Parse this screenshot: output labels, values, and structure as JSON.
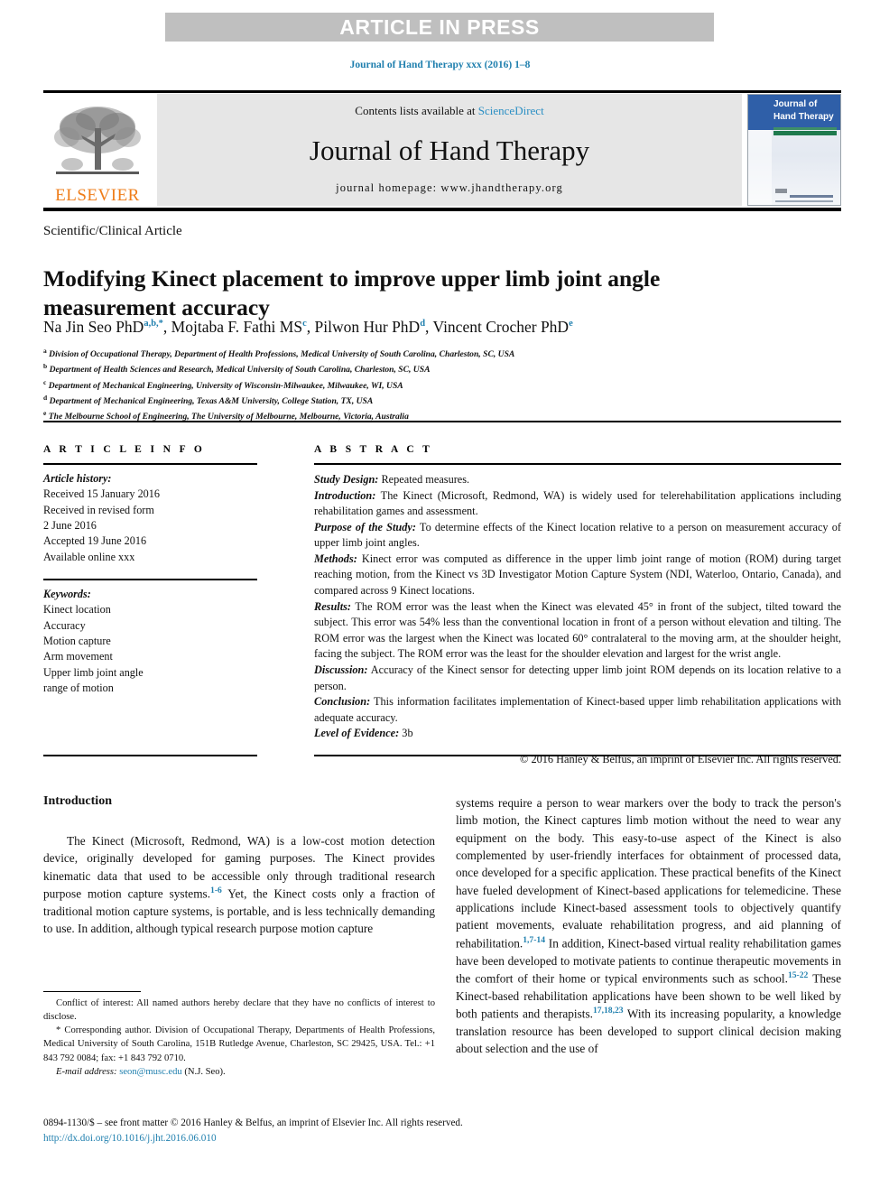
{
  "banner": {
    "label": "ARTICLE IN PRESS"
  },
  "journal_ref": "Journal of Hand Therapy xxx (2016) 1–8",
  "masthead": {
    "elsevier_wordmark": "ELSEVIER",
    "contents_prefix": "Contents lists available at ",
    "contents_link": "ScienceDirect",
    "journal_title": "Journal of Hand Therapy",
    "homepage": "journal homepage: www.jhandtherapy.org",
    "cover_title_line1": "Journal of",
    "cover_title_line2": "Hand Therapy"
  },
  "article": {
    "type": "Scientific/Clinical Article",
    "title": "Modifying Kinect placement to improve upper limb joint angle measurement accuracy",
    "authors_html": "Na Jin Seo PhD<sup>a,b,*</sup>, Mojtaba F. Fathi MS<sup>c</sup>, Pilwon Hur PhD<sup>d</sup>, Vincent Crocher PhD<sup>e</sup>",
    "affiliations": [
      {
        "marker": "a",
        "text": "Division of Occupational Therapy, Department of Health Professions, Medical University of South Carolina, Charleston, SC, USA"
      },
      {
        "marker": "b",
        "text": "Department of Health Sciences and Research, Medical University of South Carolina, Charleston, SC, USA"
      },
      {
        "marker": "c",
        "text": "Department of Mechanical Engineering, University of Wisconsin-Milwaukee, Milwaukee, WI, USA"
      },
      {
        "marker": "d",
        "text": "Department of Mechanical Engineering, Texas A&M University, College Station, TX, USA"
      },
      {
        "marker": "e",
        "text": "The Melbourne School of Engineering, The University of Melbourne, Melbourne, Victoria, Australia"
      }
    ]
  },
  "article_info": {
    "heading": "A R T I C L E   I N F O",
    "history_label": "Article history:",
    "history": [
      "Received 15 January 2016",
      "Received in revised form",
      "2 June 2016",
      "Accepted 19 June 2016",
      "Available online xxx"
    ],
    "keywords_label": "Keywords:",
    "keywords": [
      "Kinect location",
      "Accuracy",
      "Motion capture",
      "Arm movement",
      "Upper limb joint angle",
      "range of motion"
    ]
  },
  "abstract": {
    "heading": "A B S T R A C T",
    "sections": [
      {
        "label": "Study Design:",
        "text": " Repeated measures."
      },
      {
        "label": "Introduction:",
        "text": " The Kinect (Microsoft, Redmond, WA) is widely used for telerehabilitation applications including rehabilitation games and assessment."
      },
      {
        "label": "Purpose of the Study:",
        "text": " To determine effects of the Kinect location relative to a person on measurement accuracy of upper limb joint angles."
      },
      {
        "label": "Methods:",
        "text": " Kinect error was computed as difference in the upper limb joint range of motion (ROM) during target reaching motion, from the Kinect vs 3D Investigator Motion Capture System (NDI, Waterloo, Ontario, Canada), and compared across 9 Kinect locations."
      },
      {
        "label": "Results:",
        "text": " The ROM error was the least when the Kinect was elevated 45° in front of the subject, tilted toward the subject. This error was 54% less than the conventional location in front of a person without elevation and tilting. The ROM error was the largest when the Kinect was located 60° contralateral to the moving arm, at the shoulder height, facing the subject. The ROM error was the least for the shoulder elevation and largest for the wrist angle."
      },
      {
        "label": "Discussion:",
        "text": " Accuracy of the Kinect sensor for detecting upper limb joint ROM depends on its location relative to a person."
      },
      {
        "label": "Conclusion:",
        "text": " This information facilitates implementation of Kinect-based upper limb rehabilitation applications with adequate accuracy."
      },
      {
        "label": "Level of Evidence:",
        "text": " 3b"
      }
    ],
    "copyright": "© 2016 Hanley & Belfus, an imprint of Elsevier Inc. All rights reserved."
  },
  "body": {
    "intro_heading": "Introduction",
    "left_paragraph_html": "The Kinect (Microsoft, Redmond, WA) is a low-cost motion detection device, originally developed for gaming purposes. The Kinect provides kinematic data that used to be accessible only through traditional research purpose motion capture systems.<span class=\"ref\">1-6</span> Yet, the Kinect costs only a fraction of traditional motion capture systems, is portable, and is less technically demanding to use. In addition, although typical research purpose motion capture",
    "right_paragraph_html": "systems require a person to wear markers over the body to track the person's limb motion, the Kinect captures limb motion without the need to wear any equipment on the body. This easy-to-use aspect of the Kinect is also complemented by user-friendly interfaces for obtainment of processed data, once developed for a specific application. These practical benefits of the Kinect have fueled development of Kinect-based applications for telemedicine. These applications include Kinect-based assessment tools to objectively quantify patient movements, evaluate rehabilitation progress, and aid planning of rehabilitation.<span class=\"ref\">1,7-14</span> In addition, Kinect-based virtual reality rehabilitation games have been developed to motivate patients to continue therapeutic movements in the comfort of their home or typical environments such as school.<span class=\"ref\">15-22</span> These Kinect-based rehabilitation applications have been shown to be well liked by both patients and therapists.<span class=\"ref\">17,18,23</span> With its increasing popularity, a knowledge translation resource has been developed to support clinical decision making about selection and the use of"
  },
  "footnotes": {
    "conflict_html": "Conflict of interest: All named authors hereby declare that they have no conflicts of interest to disclose.",
    "corresponding_html": "* Corresponding author. Division of Occupational Therapy, Departments of Health Professions, Medical University of South Carolina, 151B Rutledge Avenue, Charleston, SC 29425, USA. Tel.: +1 843 792 0084; fax: +1 843 792 0710.",
    "email_label": "E-mail address:",
    "email": "seon@musc.edu",
    "email_suffix": " (N.J. Seo)."
  },
  "imprint": {
    "line1": "0894-1130/$ – see front matter © 2016 Hanley & Belfus, an imprint of Elsevier Inc. All rights reserved.",
    "doi": "http://dx.doi.org/10.1016/j.jht.2016.06.010"
  },
  "colors": {
    "link": "#1f7fae",
    "science_direct": "#2b8fc4",
    "elsevier_orange": "#ef7d1a",
    "banner_grey": "#bfbfbf",
    "contents_grey": "#e6e6e6",
    "cover_blue": "#2f5fa8"
  }
}
